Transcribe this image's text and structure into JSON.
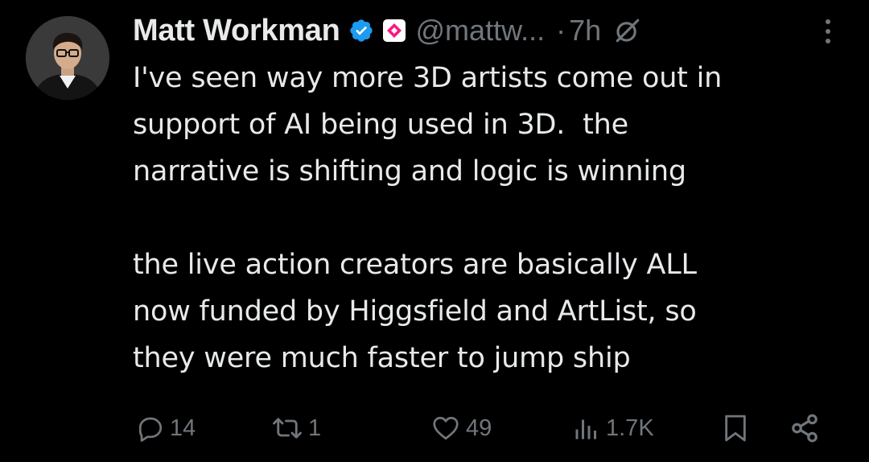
{
  "tweet": {
    "author": {
      "display_name": "Matt Workman",
      "handle": "@mattw...",
      "verified": true
    },
    "separator": "·",
    "timestamp": "7h",
    "text_lines": [
      "I've seen way more 3D artists come out in",
      "support of AI being used in 3D.  the",
      "narrative is shifting and logic is winning",
      "",
      "the live action creators are basically ALL",
      "now funded by Higgsfield and ArtList, so",
      "they were much faster to jump ship"
    ],
    "stats": {
      "replies": "14",
      "reposts": "1",
      "likes": "49",
      "views": "1.7K"
    }
  },
  "colors": {
    "background": "#000000",
    "text_primary": "#e7e9ea",
    "text_secondary": "#71767b",
    "verified_badge": "#1d9bf0",
    "affiliate_badge": "#f91880"
  },
  "icons": {
    "reply": "reply-icon",
    "repost": "repost-icon",
    "like": "heart-icon",
    "views": "views-icon",
    "bookmark": "bookmark-icon",
    "share": "share-icon",
    "grok": "grok-icon",
    "more": "more-icon"
  }
}
